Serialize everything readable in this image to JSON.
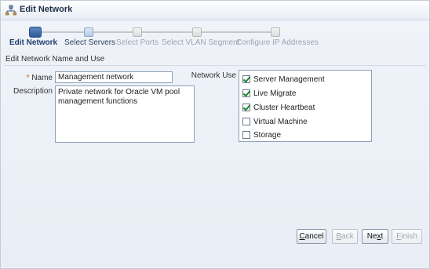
{
  "dialog": {
    "title": "Edit Network"
  },
  "train": {
    "steps": [
      {
        "label": "Edit Network",
        "state": "active"
      },
      {
        "label": "Select Servers",
        "state": "next"
      },
      {
        "label": "Select Ports",
        "state": "disabled"
      },
      {
        "label": "Select VLAN Segment",
        "state": "disabled"
      },
      {
        "label": "Configure IP Addresses",
        "state": "disabled"
      }
    ]
  },
  "form": {
    "section_label": "Edit Network Name and Use",
    "name_required_marker": "*",
    "name_label": "Name",
    "name_value": "Management network",
    "description_label": "Description",
    "description_value": "Private network for Oracle VM pool management functions",
    "network_use_label": "Network Use",
    "network_use_options": [
      {
        "label": "Server Management",
        "checked": true
      },
      {
        "label": "Live Migrate",
        "checked": true
      },
      {
        "label": "Cluster Heartbeat",
        "checked": true
      },
      {
        "label": "Virtual Machine",
        "checked": false
      },
      {
        "label": "Storage",
        "checked": false
      }
    ]
  },
  "buttons": {
    "cancel": {
      "underline": "C",
      "rest": "ancel"
    },
    "back": {
      "underline": "B",
      "rest": "ack"
    },
    "next": {
      "underline": "x",
      "pre": "Ne",
      "rest": "t"
    },
    "finish": {
      "underline": "F",
      "rest": "inish"
    }
  }
}
